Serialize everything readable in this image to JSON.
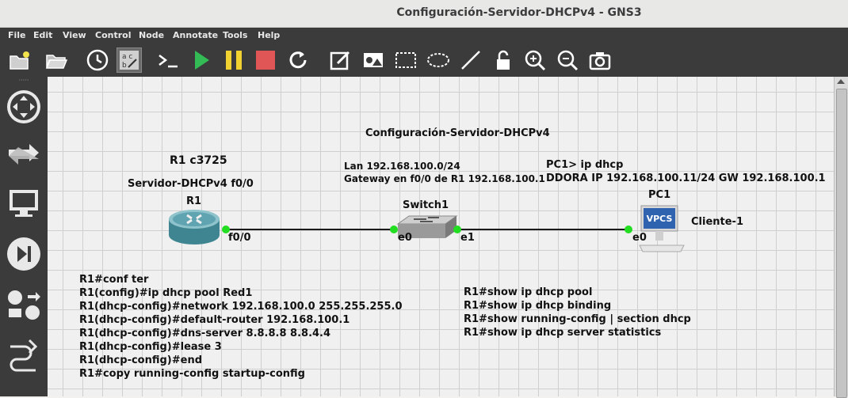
{
  "window": {
    "title": "Configuración-Servidor-DHCPv4 - GNS3"
  },
  "menu": [
    "File",
    "Edit",
    "View",
    "Control",
    "Node",
    "Annotate",
    "Tools",
    "Help"
  ],
  "toolbar_icons": [
    "new-project-icon",
    "open-project-icon",
    "snapshot-icon",
    "show-interface-labels-icon",
    "console-icon",
    "start-icon",
    "suspend-icon",
    "stop-icon",
    "reload-icon",
    "add-note-icon",
    "insert-picture-icon",
    "draw-rectangle-icon",
    "draw-ellipse-icon",
    "draw-line-icon",
    "lock-icon",
    "zoom-in-icon",
    "zoom-out-icon",
    "screenshot-icon"
  ],
  "sidebar_icons": [
    "routers-icon",
    "switches-icon",
    "end-devices-icon",
    "security-devices-icon",
    "all-devices-icon",
    "add-link-icon"
  ],
  "colors": {
    "chrome": "#3b3b3b",
    "link_endpoint": "#22dd22",
    "stop": "#e05555",
    "start": "#33bb55",
    "suspend": "#f2d230"
  },
  "canvas": {
    "topology_title": "Configuración-Servidor-DHCPv4",
    "router_model": "R1 c3725",
    "router_desc": "Servidor-DHCPv4 f0/0",
    "lan_info": "Lan 192.168.100.0/24",
    "gateway_info": "Gateway en f0/0 de R1 192.168.100.1",
    "pc_cmd": "PC1> ip dhcp",
    "pc_result": "DDORA IP 192.168.100.11/24 GW 192.168.100.1",
    "nodes": {
      "router": {
        "name": "R1",
        "port": "f0/0"
      },
      "switch": {
        "name": "Switch1",
        "port_a": "e0",
        "port_b": "e1"
      },
      "pc": {
        "name": "PC1",
        "port": "e0",
        "badge": "VPCS",
        "label": "Cliente-1"
      }
    },
    "config_commands": [
      "R1#conf ter",
      "R1(config)#ip dhcp pool Red1",
      "R1(dhcp-config)#network 192.168.100.0 255.255.255.0",
      "R1(dhcp-config)#default-router 192.168.100.1",
      "R1(dhcp-config)#dns-server 8.8.8.8 8.8.4.4",
      "R1(dhcp-config)#lease 3",
      "R1(dhcp-config)#end",
      "R1#copy running-config startup-config"
    ],
    "show_commands": [
      "R1#show ip dhcp pool",
      "R1#show ip dhcp binding",
      "R1#show running-config | section dhcp",
      "R1#show ip dhcp server statistics"
    ]
  }
}
